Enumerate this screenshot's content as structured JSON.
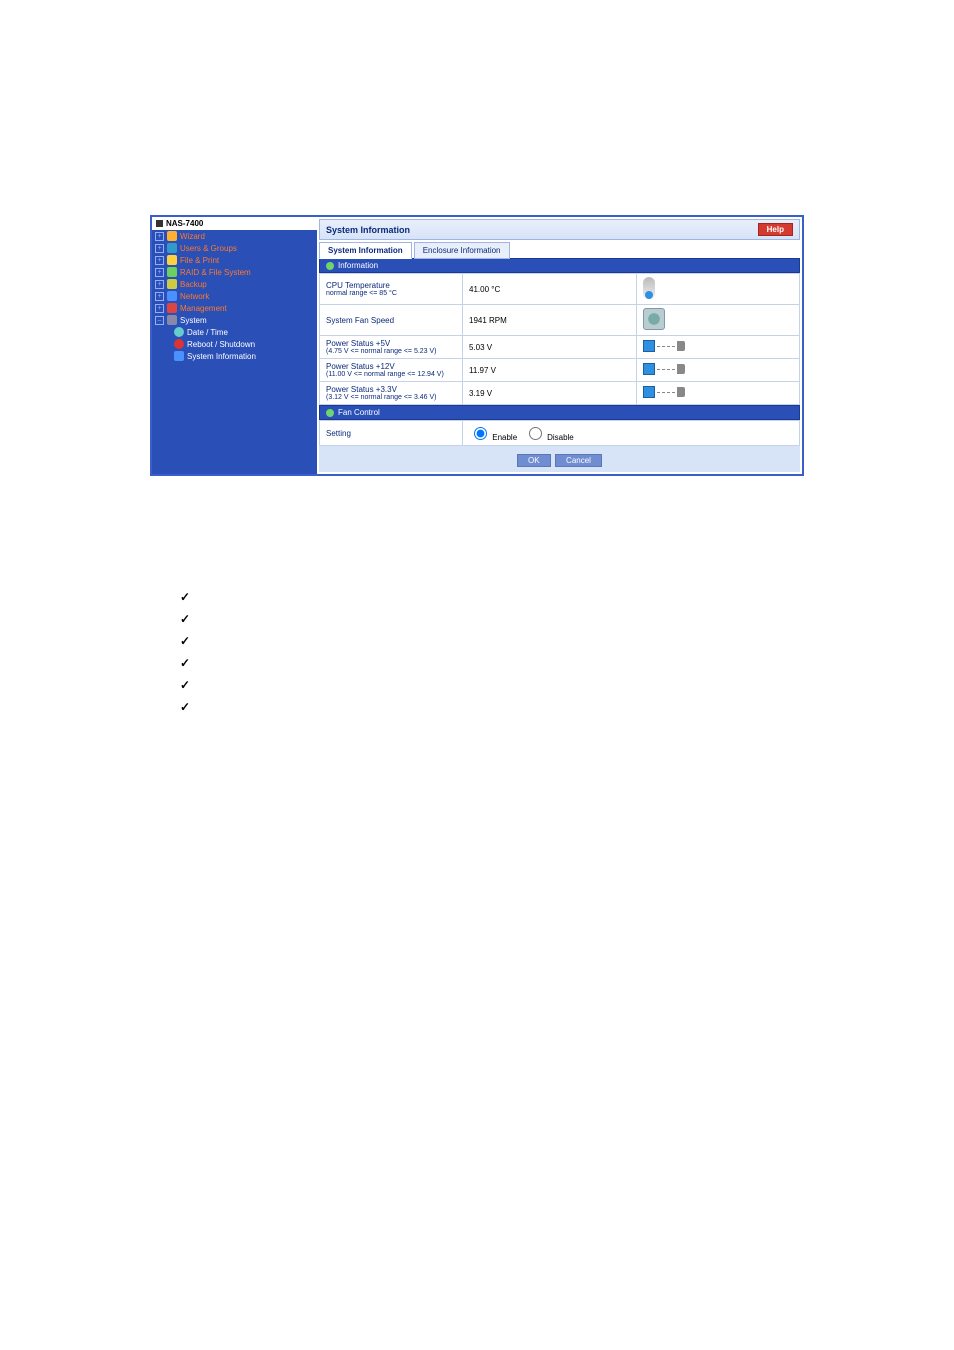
{
  "sidebar": {
    "title": "NAS-7400",
    "items": [
      {
        "label": "Wizard"
      },
      {
        "label": "Users & Groups"
      },
      {
        "label": "File & Print"
      },
      {
        "label": "RAID & File System"
      },
      {
        "label": "Backup"
      },
      {
        "label": "Network"
      },
      {
        "label": "Management"
      },
      {
        "label": "System"
      }
    ],
    "system_children": [
      {
        "label": "Date / Time"
      },
      {
        "label": "Reboot / Shutdown"
      },
      {
        "label": "System Information"
      }
    ]
  },
  "panel": {
    "title": "System Information",
    "help": "Help",
    "tabs": [
      "System Information",
      "Enclosure Information"
    ],
    "section_info": "Information",
    "rows": [
      {
        "key": "CPU Temperature",
        "sub": "normal range <= 85 °C",
        "val": "41.00 °C"
      },
      {
        "key": "System Fan Speed",
        "sub": "",
        "val": "1941 RPM"
      },
      {
        "key": "Power Status +5V",
        "sub": "(4.75 V <= normal range <= 5.23 V)",
        "val": "5.03 V"
      },
      {
        "key": "Power Status +12V",
        "sub": "(11.00 V <= normal range <= 12.94 V)",
        "val": "11.97 V"
      },
      {
        "key": "Power Status +3.3V",
        "sub": "(3.12 V <= normal range <= 3.46 V)",
        "val": "3.19 V"
      }
    ],
    "section_fan": "Fan Control",
    "fan_setting_label": "Setting",
    "fan_enable": "Enable",
    "fan_disable": "Disable",
    "ok": "OK",
    "cancel": "Cancel"
  },
  "checklist": [
    "",
    "",
    "",
    "",
    "",
    ""
  ]
}
